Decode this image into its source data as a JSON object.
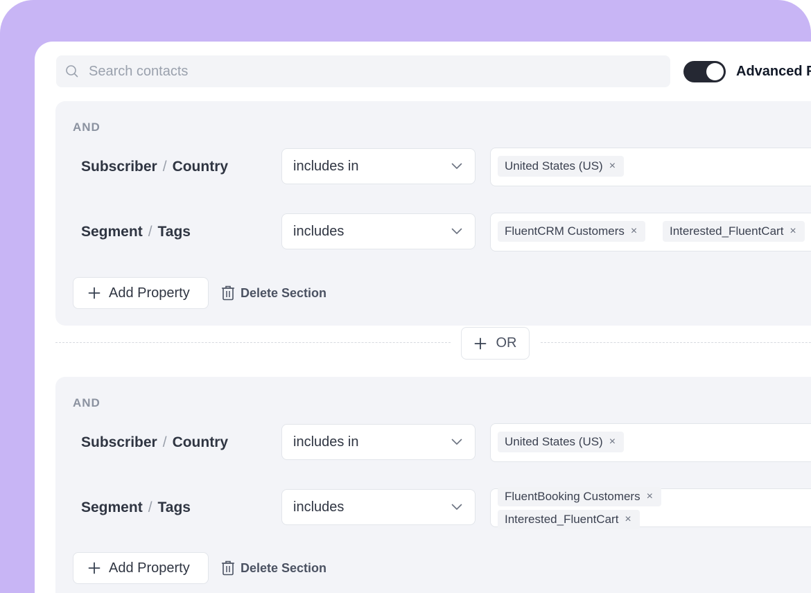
{
  "search": {
    "placeholder": "Search contacts",
    "icon": "search-icon"
  },
  "toggle": {
    "label": "Advanced F",
    "enabled": true
  },
  "or_button": {
    "label": "OR"
  },
  "sections": [
    {
      "connector": "AND",
      "rows": [
        {
          "category": "Subscriber",
          "separator": "/",
          "field": "Country",
          "operator": "includes in",
          "values": [
            "United States (US)"
          ]
        },
        {
          "category": "Segment",
          "separator": "/",
          "field": "Tags",
          "operator": "includes",
          "values": [
            "FluentCRM Customers",
            "Interested_FluentCart"
          ]
        }
      ],
      "add_property_label": "Add Property",
      "delete_section_label": "Delete Section"
    },
    {
      "connector": "AND",
      "rows": [
        {
          "category": "Subscriber",
          "separator": "/",
          "field": "Country",
          "operator": "includes in",
          "values": [
            "United States (US)"
          ]
        },
        {
          "category": "Segment",
          "separator": "/",
          "field": "Tags",
          "operator": "includes",
          "values": [
            "FluentBooking Customers",
            "Interested_FluentCart"
          ]
        }
      ],
      "add_property_label": "Add Property",
      "delete_section_label": "Delete Section"
    }
  ],
  "chip_remove_glyph": "×",
  "colors": {
    "frame": "#c8b5f5",
    "section_bg": "#f3f4f8",
    "toggle_on": "#252833"
  }
}
